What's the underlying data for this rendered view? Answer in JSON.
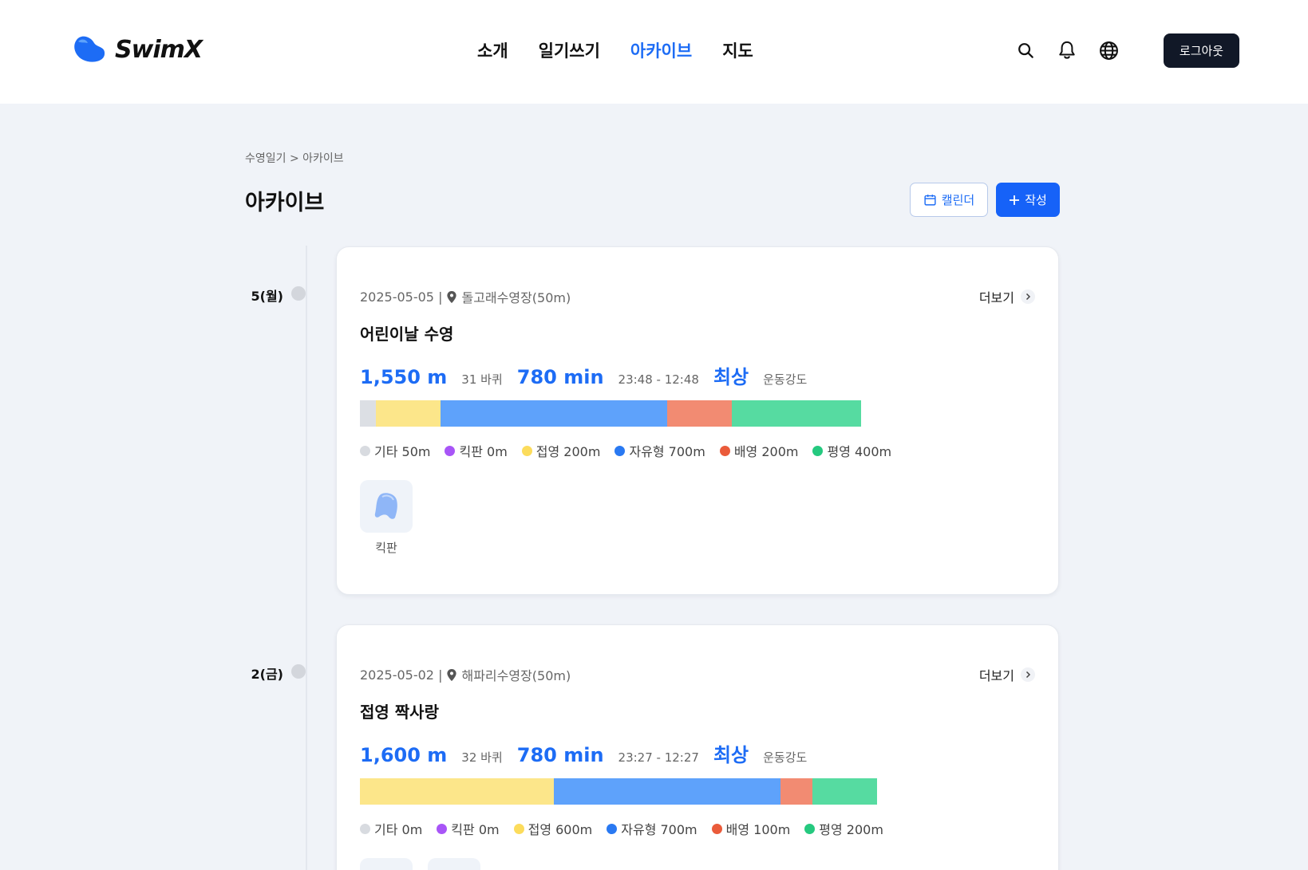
{
  "header": {
    "logo_text": "SwimX",
    "nav": [
      {
        "label": "소개",
        "active": false
      },
      {
        "label": "일기쓰기",
        "active": false
      },
      {
        "label": "아카이브",
        "active": true
      },
      {
        "label": "지도",
        "active": false
      }
    ],
    "icons": [
      "search-icon",
      "bell-icon",
      "globe-icon"
    ],
    "logout_label": "로그아웃"
  },
  "breadcrumb": "수영일기 > 아카이브",
  "page_title": "아카이브",
  "actions": {
    "calendar_label": "캘린더",
    "write_label": "작성"
  },
  "colors": {
    "accent": "#1d6cf5",
    "other": "#d8dbe0",
    "kickboard": "#a855f7",
    "butterfly": "#fce68a",
    "freestyle": "#5ea2fb",
    "backstroke": "#f28b72",
    "breaststroke": "#56dba1"
  },
  "entries": [
    {
      "day": "5(월)",
      "date": "2025-05-05 |",
      "pool": "돌고래수영장(50m)",
      "more_label": "더보기",
      "title": "어린이날 수영",
      "distance": "1,550 m",
      "laps": "31 바퀴",
      "duration": "780 min",
      "time_range": "23:48 - 12:48",
      "intensity": "최상",
      "intensity_label": "운동강도",
      "strokes": [
        {
          "name": "기타",
          "meters": 50,
          "label": "기타 50m",
          "dot": "#d8dbe0",
          "bar": "#dcdfe4"
        },
        {
          "name": "킥판",
          "meters": 0,
          "label": "킥판 0m",
          "dot": "#a855f7",
          "bar": "#a855f7"
        },
        {
          "name": "접영",
          "meters": 200,
          "label": "접영 200m",
          "dot": "#fcdc5c",
          "bar": "#fce68a"
        },
        {
          "name": "자유형",
          "meters": 700,
          "label": "자유형 700m",
          "dot": "#2979f2",
          "bar": "#5ea2fb"
        },
        {
          "name": "배영",
          "meters": 200,
          "label": "배영 200m",
          "dot": "#ea5b3a",
          "bar": "#f28b72"
        },
        {
          "name": "평영",
          "meters": 400,
          "label": "평영 400m",
          "dot": "#25c97f",
          "bar": "#56dba1"
        }
      ],
      "equipment": [
        {
          "label": "킥판",
          "icon": "kickboard-icon"
        }
      ]
    },
    {
      "day": "2(금)",
      "date": "2025-05-02 |",
      "pool": "해파리수영장(50m)",
      "more_label": "더보기",
      "title": "접영 짝사랑",
      "distance": "1,600 m",
      "laps": "32 바퀴",
      "duration": "780 min",
      "time_range": "23:27 - 12:27",
      "intensity": "최상",
      "intensity_label": "운동강도",
      "strokes": [
        {
          "name": "기타",
          "meters": 0,
          "label": "기타 0m",
          "dot": "#d8dbe0",
          "bar": "#dcdfe4"
        },
        {
          "name": "킥판",
          "meters": 0,
          "label": "킥판 0m",
          "dot": "#a855f7",
          "bar": "#a855f7"
        },
        {
          "name": "접영",
          "meters": 600,
          "label": "접영 600m",
          "dot": "#fcdc5c",
          "bar": "#fce68a"
        },
        {
          "name": "자유형",
          "meters": 700,
          "label": "자유형 700m",
          "dot": "#2979f2",
          "bar": "#5ea2fb"
        },
        {
          "name": "배영",
          "meters": 100,
          "label": "배영 100m",
          "dot": "#ea5b3a",
          "bar": "#f28b72"
        },
        {
          "name": "평영",
          "meters": 200,
          "label": "평영 200m",
          "dot": "#25c97f",
          "bar": "#56dba1"
        }
      ],
      "equipment": [
        {
          "label": "",
          "icon": "equipment-icon"
        },
        {
          "label": "",
          "icon": "equipment-icon"
        }
      ]
    }
  ]
}
